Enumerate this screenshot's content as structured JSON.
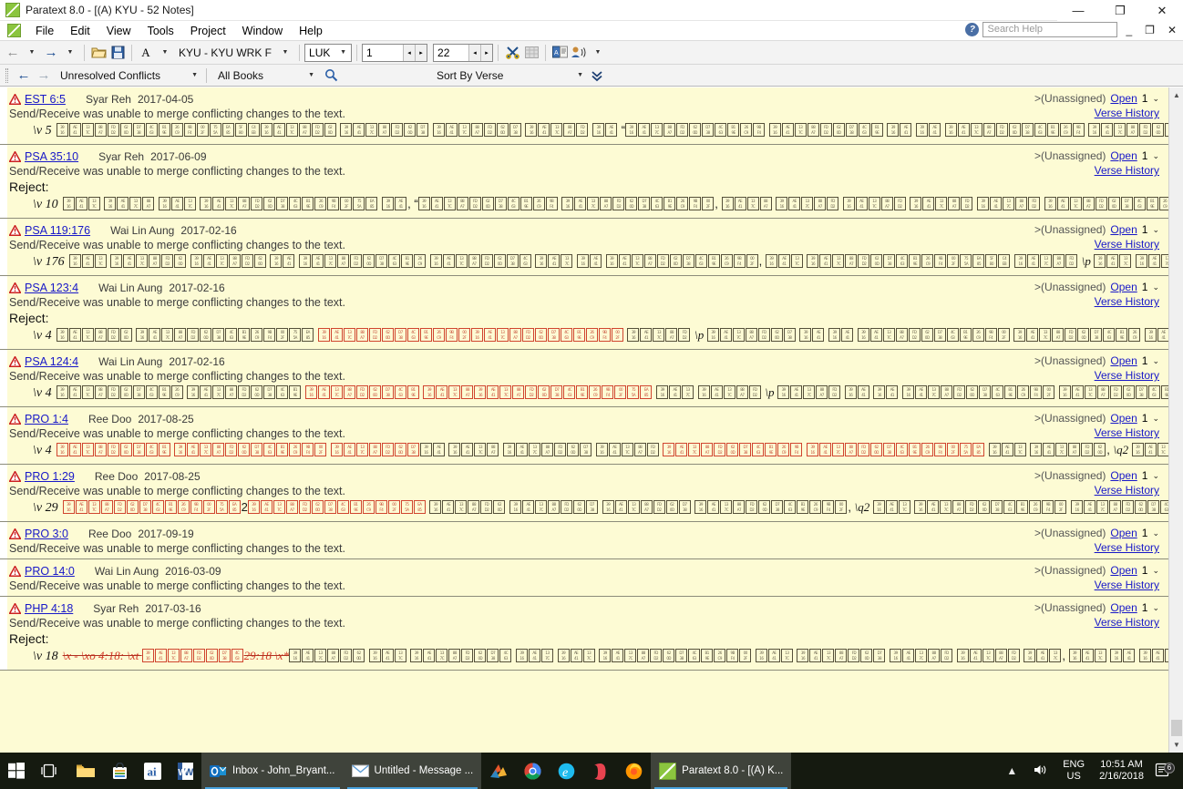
{
  "window": {
    "title": "Paratext 8.0 - [(A) KYU - 52 Notes]",
    "app_icon": "paratext-logo-icon",
    "minimize": "—",
    "maximize": "❐",
    "close": "✕"
  },
  "menu": {
    "logo_icon": "paratext-logo-icon",
    "items": [
      "File",
      "Edit",
      "View",
      "Tools",
      "Project",
      "Window",
      "Help"
    ],
    "help_icon": "help-question-icon",
    "help_search_placeholder": "Search Help",
    "mdi_minimize": "_",
    "mdi_restore": "❐",
    "mdi_close": "✕"
  },
  "toolbar": {
    "back_icon": "arrow-back-icon",
    "forward_icon": "arrow-forward-icon",
    "open_icon": "open-folder-icon",
    "save_icon": "save-disk-icon",
    "font_icon": "font-A-icon",
    "project_label": "KYU  - KYU WRK F",
    "book_value": "LUK",
    "chapter_value": "1",
    "verse_value": "22",
    "unlink_icon": "unlink-scissors-icon",
    "table_icon": "table-grid-icon",
    "translate_icon": "book-translate-icon",
    "speaker_icon": "person-speaking-icon",
    "dropdown_caret": "▾"
  },
  "filterbar": {
    "prev_icon": "arrow-left-icon",
    "next_icon": "arrow-right-icon",
    "filter_value": "Unresolved Conflicts",
    "books_value": "All Books",
    "search_icon": "search-magnifier-icon",
    "sort_value": "Sort By Verse",
    "expand_icon": "double-chevron-down-icon"
  },
  "notes_common": {
    "warning_icon": "warning-triangle-icon",
    "message": "Send/Receive was unable to merge conflicting changes to the text.",
    "reject_label": "Reject:",
    "unassigned": ">(Unassigned)",
    "open_label": "Open",
    "open_count": "1",
    "caret": "⌄",
    "verse_history": "Verse History"
  },
  "notes": [
    {
      "ref": "EST 6:5",
      "author": "Syar Reh",
      "date": "2017-04-05",
      "has_reject": false,
      "verse_num": "\\v 5",
      "segments": [
        {
          "kind": "normal",
          "boxes": 22
        },
        {
          "kind": "space"
        },
        {
          "kind": "normal",
          "boxes": 7
        },
        {
          "kind": "space"
        },
        {
          "kind": "normal",
          "boxes": 7
        },
        {
          "kind": "space"
        },
        {
          "kind": "normal",
          "boxes": 5
        },
        {
          "kind": "space"
        },
        {
          "kind": "normal",
          "boxes": 2
        },
        {
          "kind": "space"
        },
        {
          "kind": "text",
          "value": "“"
        },
        {
          "kind": "normal",
          "boxes": 11
        },
        {
          "kind": "space"
        },
        {
          "kind": "normal",
          "boxes": 9
        },
        {
          "kind": "space"
        },
        {
          "kind": "normal",
          "boxes": 2
        },
        {
          "kind": "space"
        },
        {
          "kind": "normal",
          "boxes": 2
        },
        {
          "kind": "space"
        },
        {
          "kind": "normal",
          "boxes": 11
        },
        {
          "kind": "space"
        },
        {
          "kind": "normal",
          "boxes": 8
        },
        {
          "kind": "space"
        },
        {
          "kind": "normal",
          "boxes": 5
        },
        {
          "kind": "text",
          "value": ",”"
        },
        {
          "kind": "space"
        },
        {
          "kind": "normal",
          "boxes": 4
        },
        {
          "kind": "space"
        },
        {
          "kind": "normal",
          "boxes": 3
        },
        {
          "kind": "space"
        },
        {
          "kind": "normal",
          "boxes": 3
        }
      ]
    },
    {
      "ref": "PSA 35:10",
      "author": "Syar Reh",
      "date": "2017-06-09",
      "has_reject": true,
      "verse_num": "\\v 10",
      "segments": [
        {
          "kind": "normal",
          "boxes": 3
        },
        {
          "kind": "space"
        },
        {
          "kind": "normal",
          "boxes": 4
        },
        {
          "kind": "space"
        },
        {
          "kind": "normal",
          "boxes": 3
        },
        {
          "kind": "space"
        },
        {
          "kind": "normal",
          "boxes": 14
        },
        {
          "kind": "space"
        },
        {
          "kind": "normal",
          "boxes": 2
        },
        {
          "kind": "text",
          "value": ", “"
        },
        {
          "kind": "normal",
          "boxes": 11
        },
        {
          "kind": "space"
        },
        {
          "kind": "normal",
          "boxes": 12
        },
        {
          "kind": "text",
          "value": ", "
        },
        {
          "kind": "normal",
          "boxes": 4
        },
        {
          "kind": "space"
        },
        {
          "kind": "normal",
          "boxes": 5
        },
        {
          "kind": "space"
        },
        {
          "kind": "normal",
          "boxes": 5
        },
        {
          "kind": "space"
        },
        {
          "kind": "normal",
          "boxes": 5
        },
        {
          "kind": "space"
        },
        {
          "kind": "normal",
          "boxes": 5
        },
        {
          "kind": "space"
        },
        {
          "kind": "normal",
          "boxes": 11
        }
      ]
    },
    {
      "ref": "PSA 119:176",
      "author": "Wai Lin Aung",
      "date": "2017-02-16",
      "has_reject": false,
      "verse_num": "\\v 176",
      "segments": [
        {
          "kind": "normal",
          "boxes": 3
        },
        {
          "kind": "space"
        },
        {
          "kind": "normal",
          "boxes": 6
        },
        {
          "kind": "space"
        },
        {
          "kind": "normal",
          "boxes": 6
        },
        {
          "kind": "space"
        },
        {
          "kind": "normal",
          "boxes": 2
        },
        {
          "kind": "space"
        },
        {
          "kind": "normal",
          "boxes": 10
        },
        {
          "kind": "space"
        },
        {
          "kind": "normal",
          "boxes": 8
        },
        {
          "kind": "space"
        },
        {
          "kind": "normal",
          "boxes": 3
        },
        {
          "kind": "space"
        },
        {
          "kind": "normal",
          "boxes": 2
        },
        {
          "kind": "space"
        },
        {
          "kind": "normal",
          "boxes": 12
        },
        {
          "kind": "text",
          "value": ", "
        },
        {
          "kind": "normal",
          "boxes": 3
        },
        {
          "kind": "space"
        },
        {
          "kind": "normal",
          "boxes": 16
        },
        {
          "kind": "space"
        },
        {
          "kind": "normal",
          "boxes": 5
        },
        {
          "kind": "space"
        },
        {
          "kind": "mark",
          "value": "\\p"
        },
        {
          "kind": "space"
        },
        {
          "kind": "normal",
          "boxes": 3
        },
        {
          "kind": "space"
        },
        {
          "kind": "normal",
          "boxes": 13
        },
        {
          "kind": "space"
        },
        {
          "kind": "normal",
          "boxes": 2
        }
      ]
    },
    {
      "ref": "PSA 123:4",
      "author": "Wai Lin Aung",
      "date": "2017-02-16",
      "has_reject": true,
      "verse_num": "\\v 4",
      "segments": [
        {
          "kind": "normal",
          "boxes": 6
        },
        {
          "kind": "space"
        },
        {
          "kind": "normal",
          "boxes": 14
        },
        {
          "kind": "space"
        },
        {
          "kind": "del",
          "boxes": 12
        },
        {
          "kind": "ins",
          "boxes": 12
        },
        {
          "kind": "space"
        },
        {
          "kind": "normal",
          "boxes": 5
        },
        {
          "kind": "space"
        },
        {
          "kind": "mark",
          "value": "\\p"
        },
        {
          "kind": "space"
        },
        {
          "kind": "normal",
          "boxes": 7
        },
        {
          "kind": "space"
        },
        {
          "kind": "normal",
          "boxes": 2
        },
        {
          "kind": "space"
        },
        {
          "kind": "normal",
          "boxes": 2
        },
        {
          "kind": "space"
        },
        {
          "kind": "normal",
          "boxes": 12
        },
        {
          "kind": "space"
        },
        {
          "kind": "normal",
          "boxes": 10
        },
        {
          "kind": "space"
        },
        {
          "kind": "normal",
          "boxes": 9
        }
      ]
    },
    {
      "ref": "PSA 124:4",
      "author": "Wai Lin Aung",
      "date": "2017-02-16",
      "has_reject": false,
      "verse_num": "\\v 4",
      "segments": [
        {
          "kind": "normal",
          "boxes": 10
        },
        {
          "kind": "space"
        },
        {
          "kind": "normal",
          "boxes": 9
        },
        {
          "kind": "space"
        },
        {
          "kind": "del",
          "boxes": 9
        },
        {
          "kind": "space"
        },
        {
          "kind": "del",
          "boxes": 4
        },
        {
          "kind": "ins",
          "boxes": 14
        },
        {
          "kind": "space"
        },
        {
          "kind": "normal",
          "boxes": 3
        },
        {
          "kind": "space"
        },
        {
          "kind": "normal",
          "boxes": 5
        },
        {
          "kind": "space"
        },
        {
          "kind": "mark",
          "value": "\\p"
        },
        {
          "kind": "space"
        },
        {
          "kind": "normal",
          "boxes": 5
        },
        {
          "kind": "space"
        },
        {
          "kind": "normal",
          "boxes": 2
        },
        {
          "kind": "space"
        },
        {
          "kind": "normal",
          "boxes": 2
        },
        {
          "kind": "space"
        },
        {
          "kind": "normal",
          "boxes": 12
        },
        {
          "kind": "space"
        },
        {
          "kind": "normal",
          "boxes": 10
        },
        {
          "kind": "space"
        },
        {
          "kind": "normal",
          "boxes": 2
        }
      ]
    },
    {
      "ref": "PRO 1:4",
      "author": "Ree Doo",
      "date": "2017-08-25",
      "has_reject": false,
      "verse_num": "\\v 4",
      "segments": [
        {
          "kind": "del",
          "boxes": 9
        },
        {
          "kind": "space"
        },
        {
          "kind": "del",
          "boxes": 12
        },
        {
          "kind": "space"
        },
        {
          "kind": "del",
          "boxes": 7
        },
        {
          "kind": "normal",
          "boxes": 2
        },
        {
          "kind": "space"
        },
        {
          "kind": "normal",
          "boxes": 4
        },
        {
          "kind": "space"
        },
        {
          "kind": "normal",
          "boxes": 7
        },
        {
          "kind": "space"
        },
        {
          "kind": "normal",
          "boxes": 5
        },
        {
          "kind": "space"
        },
        {
          "kind": "del",
          "boxes": 11
        },
        {
          "kind": "space"
        },
        {
          "kind": "ins",
          "boxes": 14
        },
        {
          "kind": "space"
        },
        {
          "kind": "normal",
          "boxes": 3
        },
        {
          "kind": "space"
        },
        {
          "kind": "normal",
          "boxes": 6
        },
        {
          "kind": "text",
          "value": ", "
        },
        {
          "kind": "mark",
          "value": "\\q2"
        },
        {
          "kind": "space"
        },
        {
          "kind": "normal",
          "boxes": 3
        },
        {
          "kind": "space"
        },
        {
          "kind": "normal",
          "boxes": 2
        },
        {
          "kind": "space"
        },
        {
          "kind": "normal",
          "boxes": 3
        }
      ]
    },
    {
      "ref": "PRO 1:29",
      "author": "Ree Doo",
      "date": "2017-08-25",
      "has_reject": false,
      "verse_num": "\\v 29",
      "segments": [
        {
          "kind": "del",
          "boxes": 14
        },
        {
          "kind": "text",
          "value": "2"
        },
        {
          "kind": "ins",
          "boxes": 14
        },
        {
          "kind": "space"
        },
        {
          "kind": "normal",
          "boxes": 6
        },
        {
          "kind": "space"
        },
        {
          "kind": "normal",
          "boxes": 7
        },
        {
          "kind": "space"
        },
        {
          "kind": "normal",
          "boxes": 7
        },
        {
          "kind": "space"
        },
        {
          "kind": "normal",
          "boxes": 12
        },
        {
          "kind": "text",
          "value": ", "
        },
        {
          "kind": "mark",
          "value": "\\q2"
        },
        {
          "kind": "space"
        },
        {
          "kind": "normal",
          "boxes": 3
        },
        {
          "kind": "space"
        },
        {
          "kind": "normal",
          "boxes": 12
        },
        {
          "kind": "space"
        },
        {
          "kind": "normal",
          "boxes": 9
        }
      ]
    },
    {
      "ref": "PRO 3:0",
      "author": "Ree Doo",
      "date": "2017-09-19",
      "has_reject": false,
      "verse_num": "",
      "segments": []
    },
    {
      "ref": "PRO 14:0",
      "author": "Wai Lin Aung",
      "date": "2016-03-09",
      "has_reject": false,
      "verse_num": "",
      "segments": []
    },
    {
      "ref": "PHP 4:18",
      "author": "Syar Reh",
      "date": "2017-03-16",
      "has_reject": true,
      "verse_num": "\\v 18",
      "segments": [
        {
          "kind": "del-text",
          "value": "\\x - \\xo 4:18: \\xt "
        },
        {
          "kind": "del",
          "boxes": 8
        },
        {
          "kind": "del-text",
          "value": "29:18 \\x*"
        },
        {
          "kind": "normal",
          "boxes": 6
        },
        {
          "kind": "space"
        },
        {
          "kind": "normal",
          "boxes": 3
        },
        {
          "kind": "space"
        },
        {
          "kind": "normal",
          "boxes": 8
        },
        {
          "kind": "space"
        },
        {
          "kind": "normal",
          "boxes": 3
        },
        {
          "kind": "space"
        },
        {
          "kind": "normal",
          "boxes": 3
        },
        {
          "kind": "space"
        },
        {
          "kind": "normal",
          "boxes": 12
        },
        {
          "kind": "space"
        },
        {
          "kind": "normal",
          "boxes": 3
        },
        {
          "kind": "space"
        },
        {
          "kind": "normal",
          "boxes": 7
        },
        {
          "kind": "space"
        },
        {
          "kind": "normal",
          "boxes": 5
        },
        {
          "kind": "space"
        },
        {
          "kind": "normal",
          "boxes": 5
        },
        {
          "kind": "space"
        },
        {
          "kind": "normal",
          "boxes": 3
        },
        {
          "kind": "text",
          "value": ", "
        },
        {
          "kind": "normal",
          "boxes": 3
        },
        {
          "kind": "space"
        },
        {
          "kind": "normal",
          "boxes": 2
        },
        {
          "kind": "space"
        },
        {
          "kind": "normal",
          "boxes": 5
        },
        {
          "kind": "space"
        },
        {
          "kind": "normal",
          "boxes": 7
        }
      ]
    }
  ],
  "scrollbar": {
    "up_icon": "chevron-up-icon",
    "down_icon": "chevron-down-icon"
  },
  "taskbar": {
    "start_icon": "windows-start-icon",
    "taskview_icon": "task-view-icon",
    "explorer_icon": "file-explorer-icon",
    "store_icon": "microsoft-store-icon",
    "adobe_icon": "adobe-illustrator-icon",
    "word_icon": "microsoft-word-icon",
    "outlook_icon": "outlook-icon",
    "outlook_title": "Inbox - John_Bryant...",
    "message_icon": "mail-message-icon",
    "message_title": "Untitled - Message ...",
    "colorful_icon": "colorful-app-icon",
    "chrome_icon": "chrome-icon",
    "ie_icon": "internet-explorer-icon",
    "opera_icon": "opera-icon",
    "firefox_icon": "firefox-icon",
    "paratext_icon": "paratext-logo-icon",
    "paratext_title": "Paratext 8.0 - [(A) K...",
    "show_hidden_icon": "chevron-up-icon",
    "volume_icon": "speaker-icon",
    "lang_line1": "ENG",
    "lang_line2": "US",
    "time": "10:51 AM",
    "date": "2/16/2018",
    "notification_icon": "notification-icon",
    "notification_count": "6"
  },
  "colors": {
    "note_bg": "#fdfbd4",
    "link": "#1818c8",
    "delete_red": "#d63b28",
    "taskbar": "#151a10"
  }
}
